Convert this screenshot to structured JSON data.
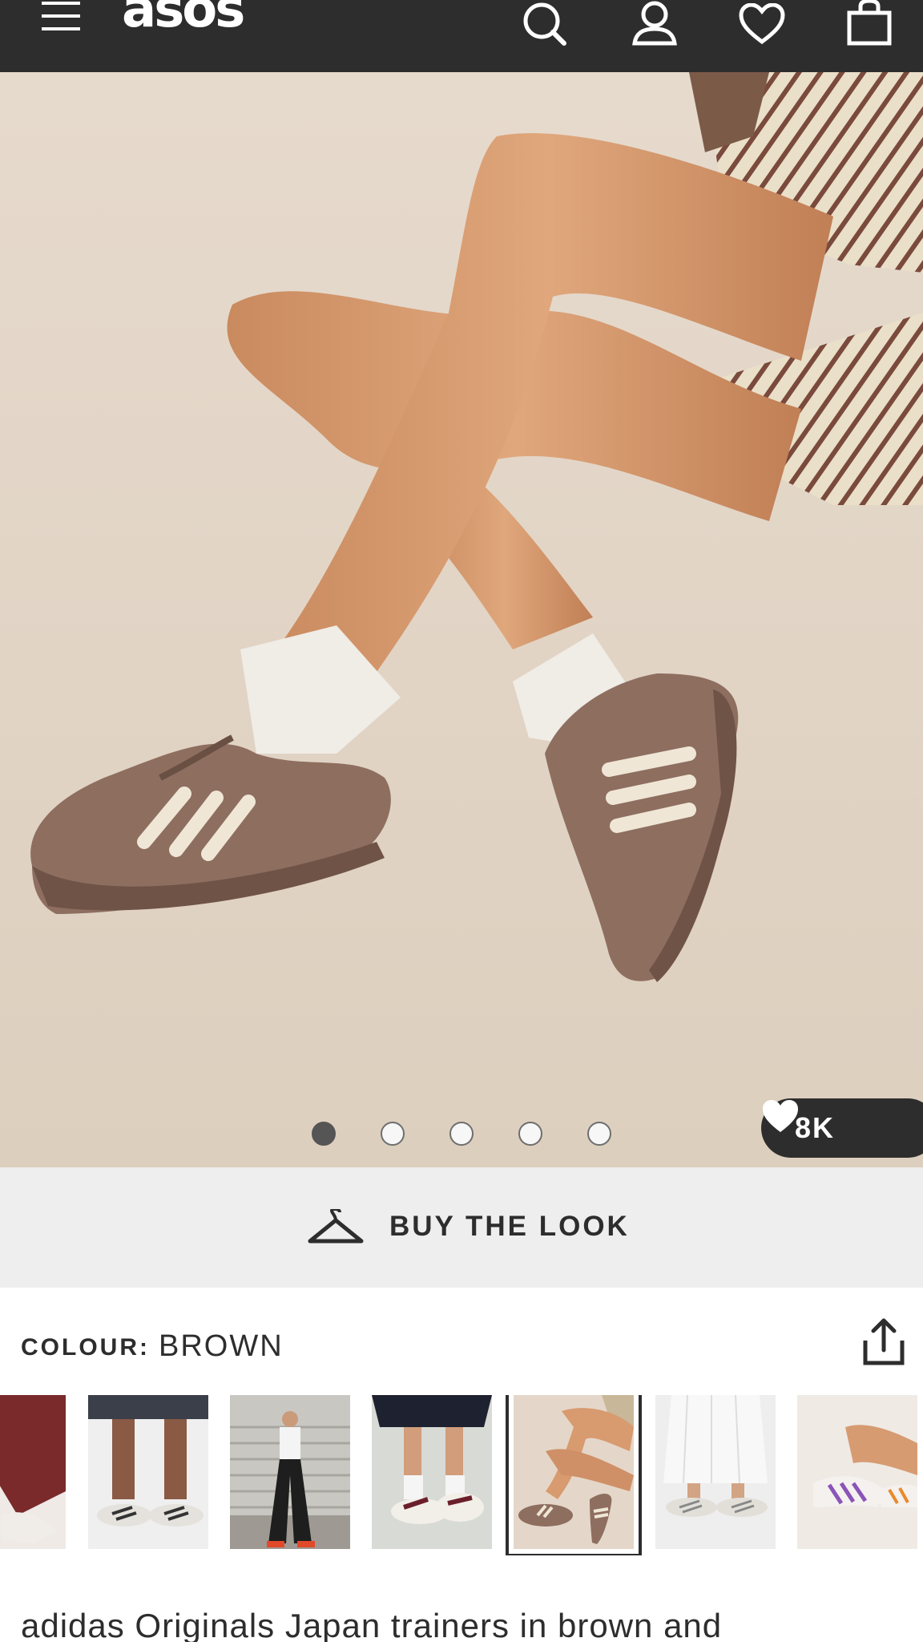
{
  "header": {
    "logo": "asos",
    "icons": [
      "menu-icon",
      "search-icon",
      "account-icon",
      "heart-icon",
      "bag-icon"
    ]
  },
  "gallery": {
    "image_count": 5,
    "active_index": 0,
    "save_count": "8K"
  },
  "buy_the_look": {
    "label": "BUY THE LOOK"
  },
  "colour": {
    "label": "COLOUR:",
    "value": "BROWN"
  },
  "thumbnails": {
    "count": 7,
    "selected_index": 4
  },
  "product": {
    "title": "adidas Originals Japan trainers in brown and"
  },
  "colors": {
    "header_bg": "#2d2d2d",
    "panel_bg": "#eeeeee",
    "text": "#2d2d2d"
  }
}
